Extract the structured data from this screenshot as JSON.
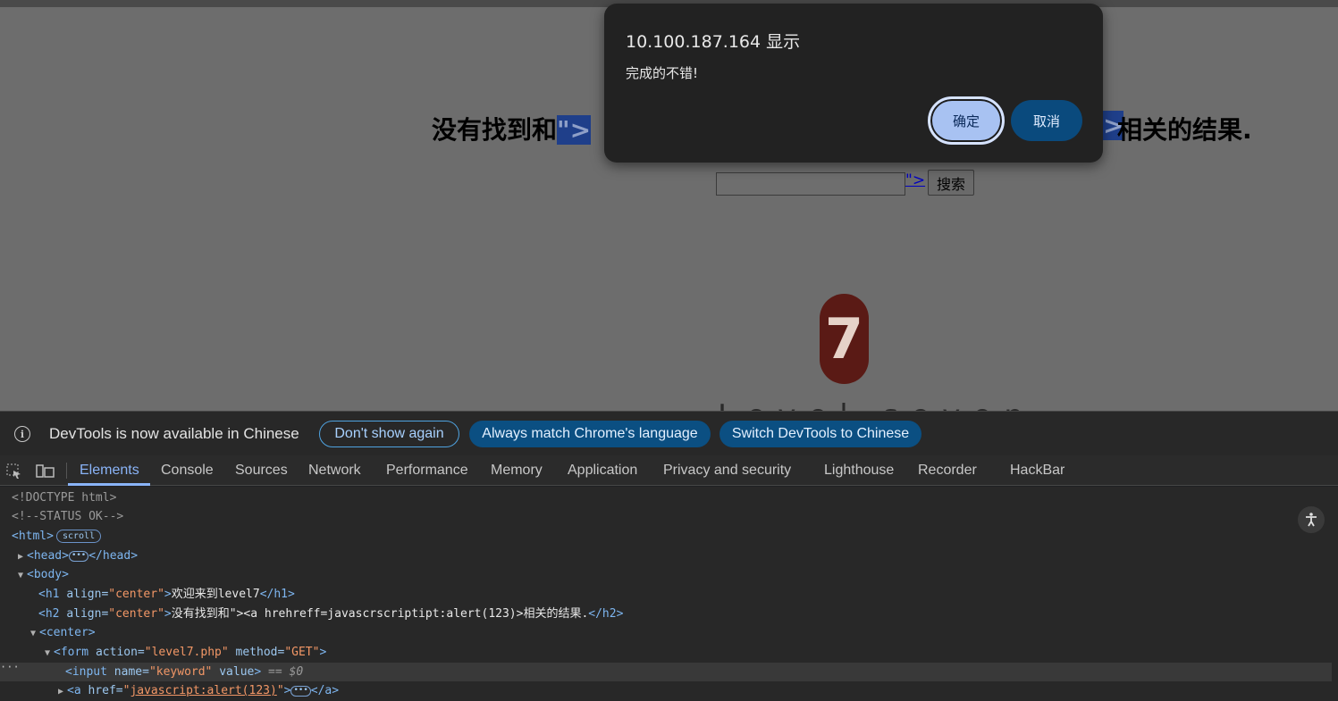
{
  "page": {
    "h2_prefix": "没有找到和",
    "h2_hl_left": "\">",
    "h2_hl_right": ">",
    "h2_suffix": "相关的结果.",
    "link_text": "\">",
    "search_button": "搜索",
    "badge_number": "7",
    "level_text": "Level seven"
  },
  "dialog": {
    "title": "10.100.187.164 显示",
    "message": "完成的不错!",
    "ok_label": "确定",
    "cancel_label": "取消"
  },
  "infobar": {
    "text": "DevTools is now available in Chinese",
    "btn_dont_show": "Don't show again",
    "btn_match": "Always match Chrome's language",
    "btn_switch": "Switch DevTools to Chinese"
  },
  "tabs": [
    "Elements",
    "Console",
    "Sources",
    "Network",
    "Performance",
    "Memory",
    "Application",
    "Privacy and security",
    "Lighthouse",
    "Recorder",
    "HackBar"
  ],
  "tree": {
    "doctype": "<!DOCTYPE html>",
    "comment": "<!--STATUS OK-->",
    "html_open": "<html>",
    "scroll_pill": "scroll",
    "head_open": "<head>",
    "head_close": "</head>",
    "body_open": "<body>",
    "h1_open": "<h1 ",
    "h1_attr": "align=",
    "h1_val": "\"center\"",
    "h1_text": "欢迎来到level7",
    "h1_close": "</h1>",
    "h2_open": "<h2 ",
    "h2_attr": "align=",
    "h2_val": "\"center\"",
    "h2_text": "没有找到和\"><a hrehreff=javascrscriptipt:alert(123)>相关的结果.",
    "h2_close": "</h2>",
    "center_open": "<center>",
    "form_open": "<form ",
    "form_attr1": "action=",
    "form_val1": "\"level7.php\"",
    "form_attr2": " method=",
    "form_val2": "\"GET\"",
    "input_open": "<input ",
    "input_attr1": "name=",
    "input_val1": "\"keyword\"",
    "input_attr2": " value",
    "input_end": ">",
    "input_eq": " == $0",
    "a_open": "<a ",
    "a_attr": "href=",
    "a_val": "javascript:alert(123)",
    "a_close": "</a>"
  }
}
